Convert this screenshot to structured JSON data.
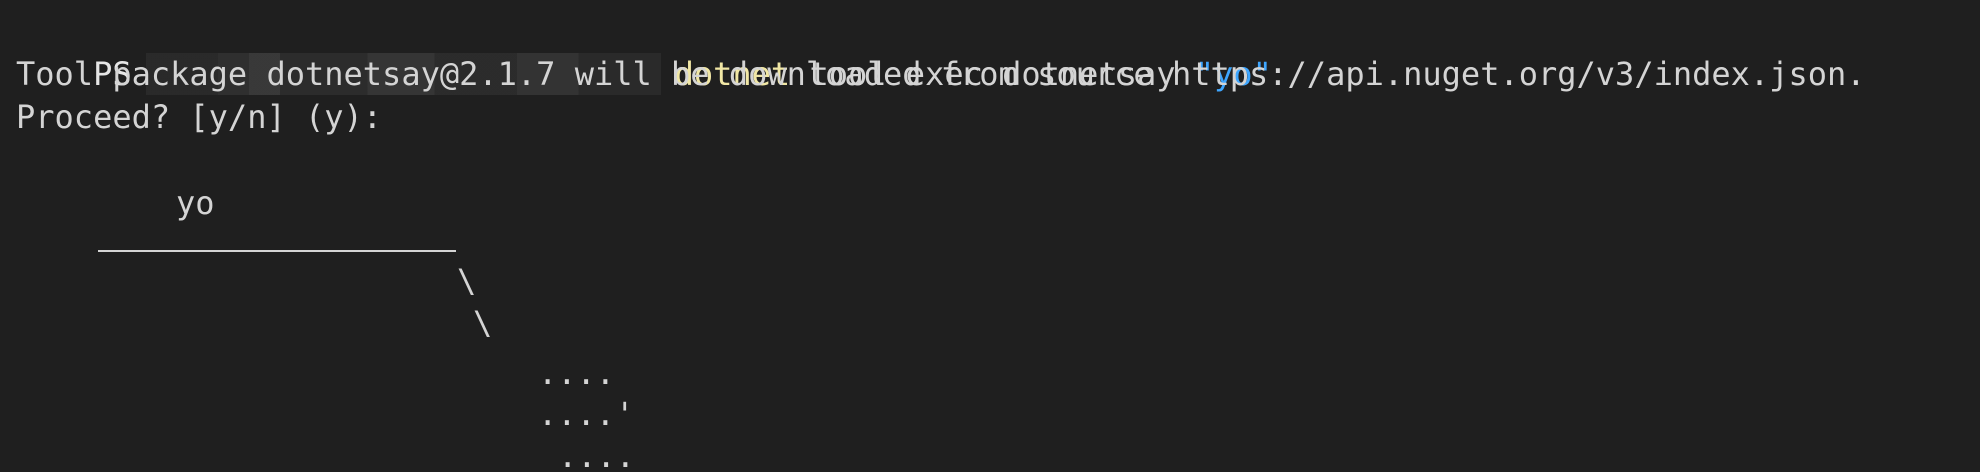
{
  "terminal": {
    "prompt_prefix": "PS",
    "command": "dotnet",
    "arguments": " tool exec dotnetsay ",
    "quoted_argument": "\"yo\"",
    "download_message": "Tool package dotnetsay@2.1.7 will be downloaded from source https://api.nuget.org/v3/index.json.",
    "confirmation_prompt": "Proceed? [y/n] (y):"
  },
  "ascii_art": {
    "speech_text": "yo",
    "slash_1": "\\",
    "slash_2": "\\",
    "dots_1": "....",
    "dots_2": "....'",
    "dots_3": "...."
  },
  "colors": {
    "background": "#1f1f1f",
    "text": "#d4d4d4",
    "command": "#f1e7a5",
    "string": "#3ea6ff"
  }
}
